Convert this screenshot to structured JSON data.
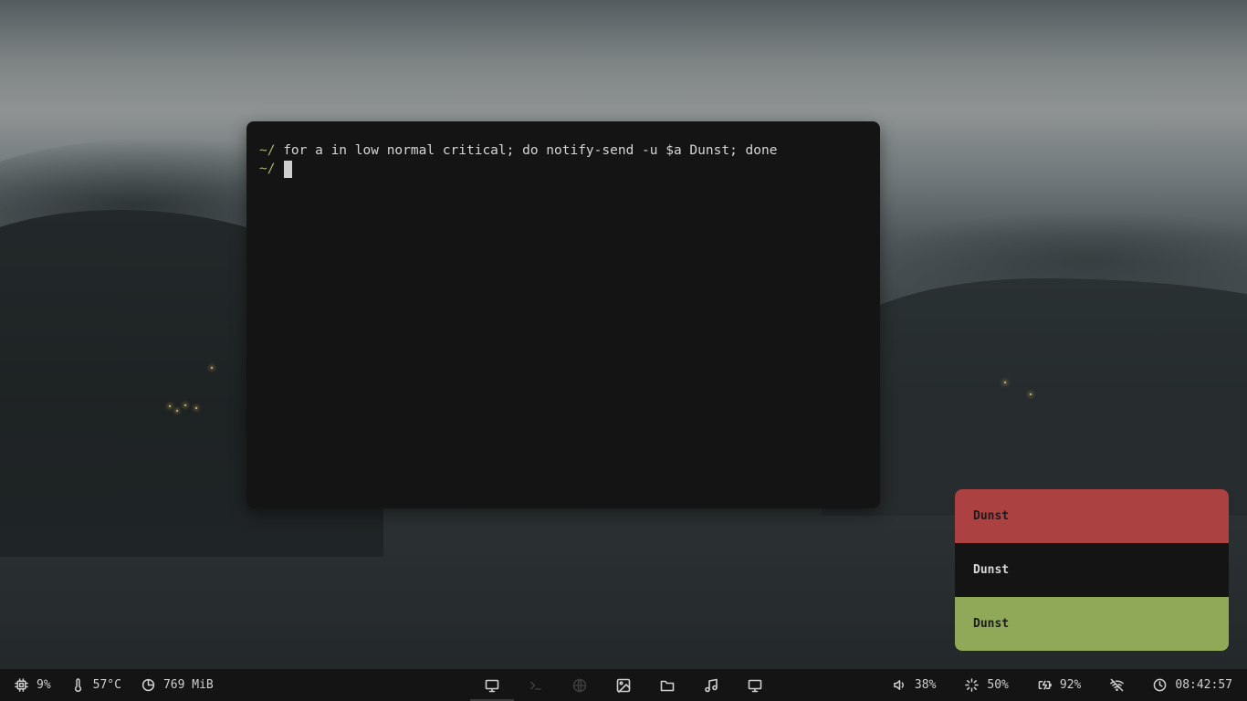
{
  "terminal": {
    "lines": [
      {
        "prompt": "~/",
        "command": "for a in low normal critical; do notify-send -u $a Dunst; done"
      },
      {
        "prompt": "~/",
        "command": ""
      }
    ]
  },
  "notifications": [
    {
      "text": "Dunst",
      "urgency": "critical",
      "color": "#ac4142"
    },
    {
      "text": "Dunst",
      "urgency": "normal",
      "color": "#141414"
    },
    {
      "text": "Dunst",
      "urgency": "low",
      "color": "#90a959"
    }
  ],
  "bar": {
    "left": [
      {
        "icon": "cpu-icon",
        "value": "9%"
      },
      {
        "icon": "thermometer-icon",
        "value": "57°C"
      },
      {
        "icon": "memory-pie-icon",
        "value": "769 MiB"
      }
    ],
    "workspaces": [
      {
        "icon": "monitor-icon",
        "active": true
      },
      {
        "icon": "terminal-icon",
        "dim": true
      },
      {
        "icon": "globe-icon",
        "dim": true
      },
      {
        "icon": "image-icon"
      },
      {
        "icon": "folder-icon"
      },
      {
        "icon": "music-icon"
      },
      {
        "icon": "monitor-icon"
      }
    ],
    "right": [
      {
        "icon": "volume-icon",
        "value": "38%"
      },
      {
        "icon": "brightness-icon",
        "value": "50%"
      },
      {
        "icon": "battery-charging-icon",
        "value": "92%"
      },
      {
        "icon": "wifi-off-icon",
        "value": ""
      },
      {
        "icon": "clock-icon",
        "value": "08:42:57"
      }
    ]
  },
  "colors": {
    "prompt": "#a3b46a",
    "terminal_bg": "#141414",
    "critical": "#ac4142",
    "low": "#90a959"
  }
}
